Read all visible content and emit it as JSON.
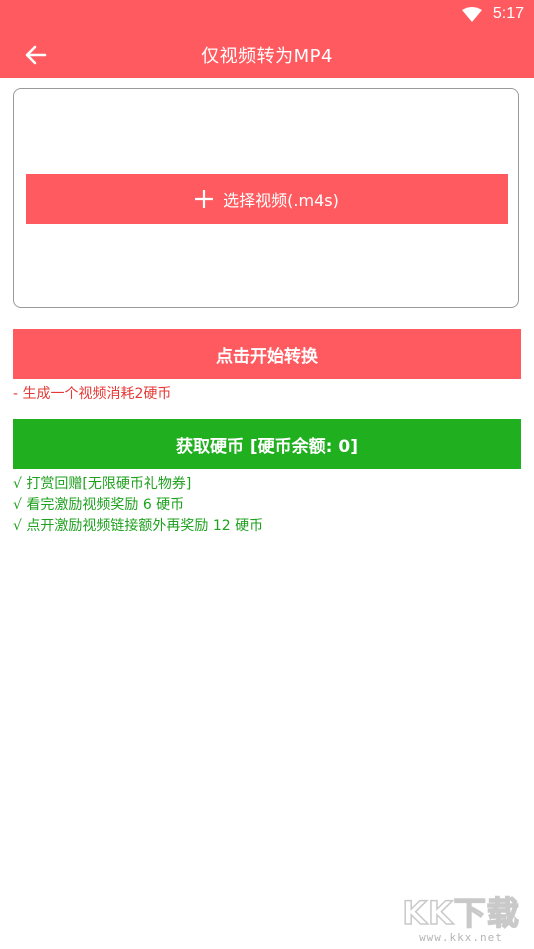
{
  "status_bar": {
    "time": "5:17",
    "wifi_icon": "wifi-icon"
  },
  "app_bar": {
    "title": "仅视频转为MP4",
    "back_icon": "arrow-left-icon"
  },
  "picker": {
    "icon": "plus-icon",
    "label": "选择视频(.m4s)"
  },
  "convert": {
    "label": "点击开始转换",
    "note": "- 生成一个视频消耗2硬币"
  },
  "coins": {
    "label": "获取硬币 [硬币余额: 0]",
    "perks": [
      "√ 打赏回赠[无限硬币礼物券]",
      "√ 看完激励视频奖励 6 硬币",
      "√ 点开激励视频链接额外再奖励 12 硬币"
    ]
  },
  "watermark": {
    "logo": "KK下载",
    "url": "www.kkx.net"
  },
  "colors": {
    "accent": "#FF5A5F",
    "success": "#1FAF1F",
    "note_red": "#E53935"
  }
}
